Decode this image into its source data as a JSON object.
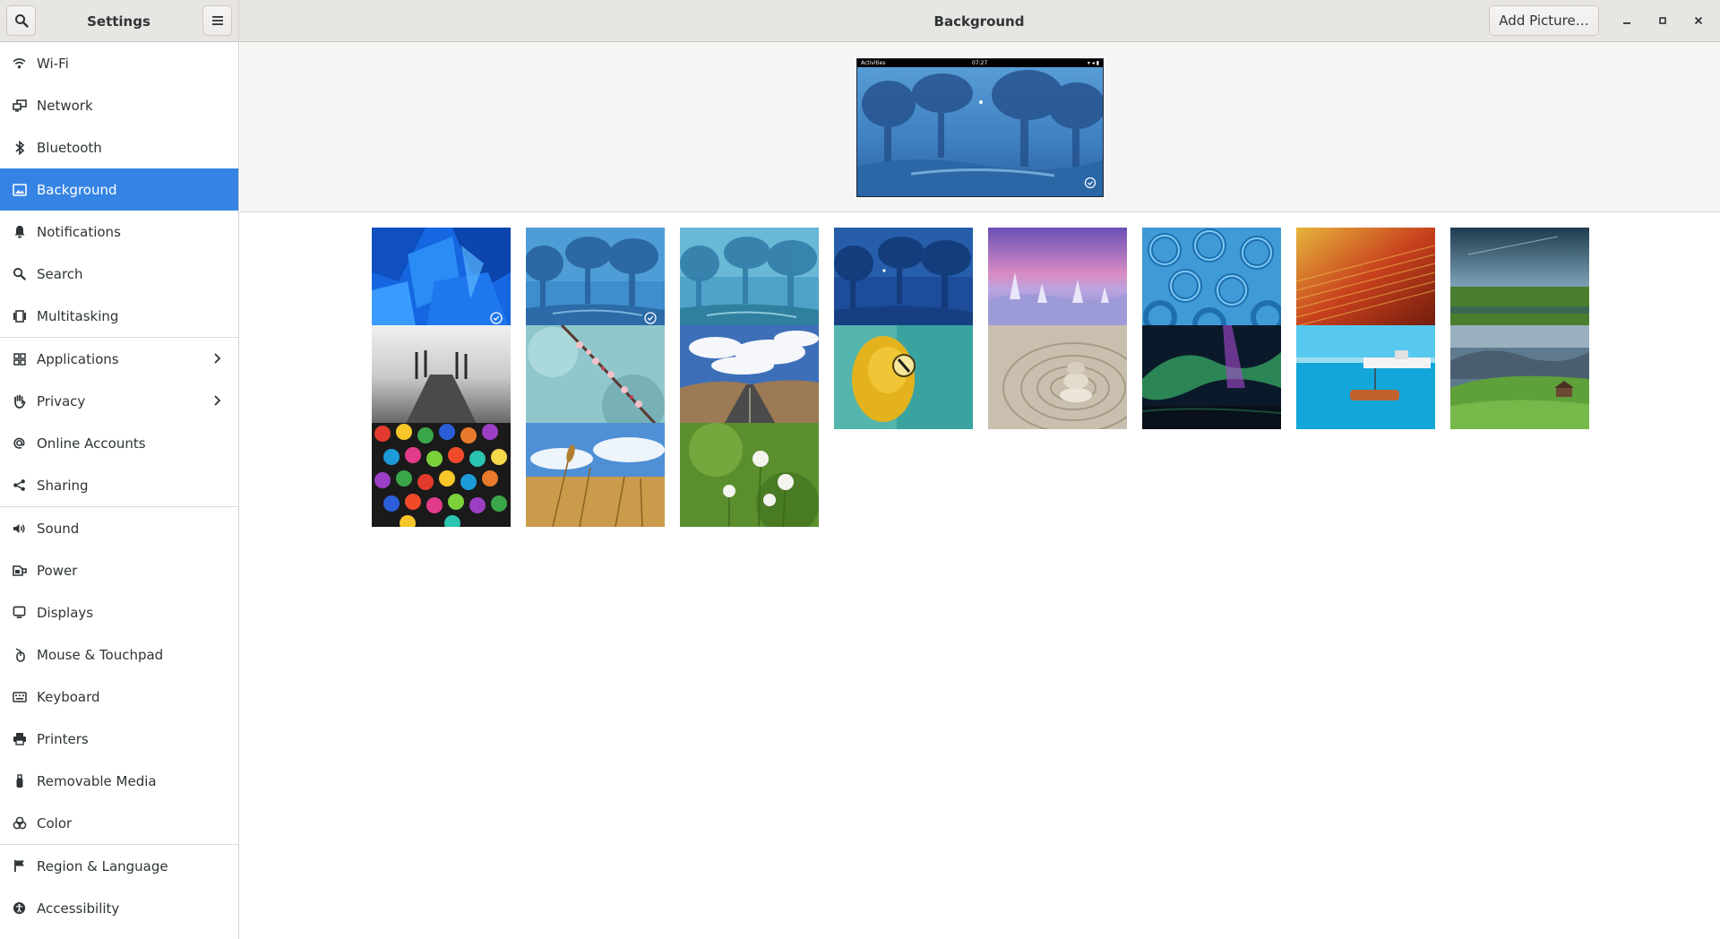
{
  "window": {
    "app_title": "Settings",
    "page_title": "Background",
    "add_picture_label": "Add Picture…"
  },
  "sidebar": {
    "items": [
      {
        "id": "wifi",
        "label": "Wi-Fi",
        "icon": "wifi-icon"
      },
      {
        "id": "network",
        "label": "Network",
        "icon": "network-icon"
      },
      {
        "id": "bluetooth",
        "label": "Bluetooth",
        "icon": "bluetooth-icon"
      },
      {
        "id": "background",
        "label": "Background",
        "icon": "background-icon",
        "selected": true
      },
      {
        "id": "notifications",
        "label": "Notifications",
        "icon": "bell-icon"
      },
      {
        "id": "search",
        "label": "Search",
        "icon": "search-icon"
      },
      {
        "id": "multitasking",
        "label": "Multitasking",
        "icon": "multitasking-icon"
      },
      {
        "id": "applications",
        "label": "Applications",
        "icon": "applications-icon",
        "has_submenu": true
      },
      {
        "id": "privacy",
        "label": "Privacy",
        "icon": "hand-icon",
        "has_submenu": true
      },
      {
        "id": "online-accounts",
        "label": "Online Accounts",
        "icon": "at-icon"
      },
      {
        "id": "sharing",
        "label": "Sharing",
        "icon": "share-icon"
      },
      {
        "id": "sound",
        "label": "Sound",
        "icon": "speaker-icon"
      },
      {
        "id": "power",
        "label": "Power",
        "icon": "power-icon"
      },
      {
        "id": "displays",
        "label": "Displays",
        "icon": "display-icon"
      },
      {
        "id": "mouse-touchpad",
        "label": "Mouse & Touchpad",
        "icon": "mouse-icon"
      },
      {
        "id": "keyboard",
        "label": "Keyboard",
        "icon": "keyboard-icon"
      },
      {
        "id": "printers",
        "label": "Printers",
        "icon": "printer-icon"
      },
      {
        "id": "removable-media",
        "label": "Removable Media",
        "icon": "usb-icon"
      },
      {
        "id": "color",
        "label": "Color",
        "icon": "color-icon"
      },
      {
        "id": "region-language",
        "label": "Region & Language",
        "icon": "flag-icon"
      },
      {
        "id": "accessibility",
        "label": "Accessibility",
        "icon": "accessibility-icon"
      }
    ],
    "separator_after": [
      "multitasking",
      "sharing",
      "color"
    ]
  },
  "preview": {
    "topbar_left": "Activities",
    "topbar_clock": "07:27"
  },
  "wallpapers": [
    {
      "name": "abstract-blue-shapes",
      "selected": true
    },
    {
      "name": "blue-forest-light",
      "selected": true
    },
    {
      "name": "blue-forest-mist",
      "selected": false
    },
    {
      "name": "blue-forest-night",
      "selected": false
    },
    {
      "name": "snowy-purple-dawn",
      "selected": false
    },
    {
      "name": "blue-rubber-rings",
      "selected": false
    },
    {
      "name": "red-fabric-macro",
      "selected": false
    },
    {
      "name": "green-field-sky",
      "selected": false
    },
    {
      "name": "misty-pier",
      "selected": false
    },
    {
      "name": "cherry-blossom",
      "selected": false
    },
    {
      "name": "desert-road",
      "selected": false
    },
    {
      "name": "yellow-frog",
      "selected": false
    },
    {
      "name": "zen-stones",
      "selected": false
    },
    {
      "name": "aurora",
      "selected": false
    },
    {
      "name": "boat-lake",
      "selected": false
    },
    {
      "name": "green-valley",
      "selected": false
    },
    {
      "name": "colored-pencils",
      "selected": false
    },
    {
      "name": "wheat-field",
      "selected": false
    },
    {
      "name": "dandelions",
      "selected": false
    }
  ],
  "colors": {
    "accent": "#3584e4",
    "headerbar": "#e8e6e3",
    "preview_bg": "#f6f5f4"
  }
}
